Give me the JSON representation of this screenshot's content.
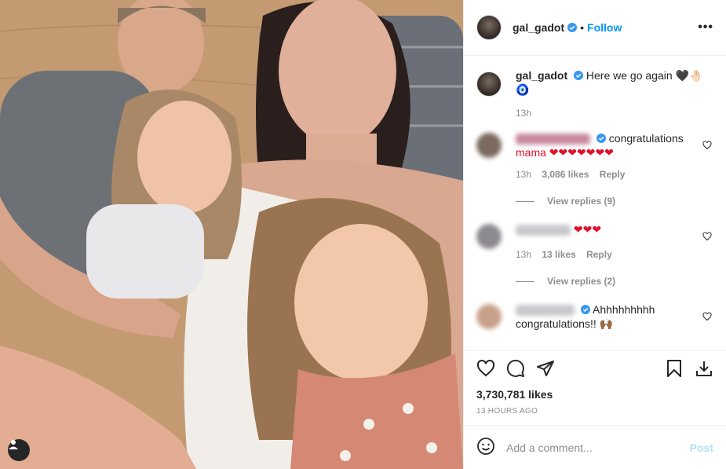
{
  "author": {
    "username": "gal_gadot",
    "verified": true,
    "follow_label": "Follow",
    "separator": "•"
  },
  "caption": {
    "username": "gal_gadot",
    "text": "Here we go again 🖤🤚🏻",
    "text2": "🧿",
    "time": "13h"
  },
  "comments": [
    {
      "text": "congratulations",
      "text2": "mama ❤❤❤❤❤❤❤",
      "time": "13h",
      "likes": "3,086 likes",
      "reply_label": "Reply",
      "view_replies": "View replies (9)"
    },
    {
      "text": "❤❤❤",
      "time": "13h",
      "likes": "13 likes",
      "reply_label": "Reply",
      "view_replies": "View replies (2)"
    },
    {
      "text": "Ahhhhhhhhh",
      "text2": "congratulations!! 🙌🏾"
    }
  ],
  "likes_count": "3,730,781 likes",
  "posted_ago": "13 HOURS AGO",
  "add_comment": {
    "placeholder": "Add a comment...",
    "post_label": "Post"
  },
  "icons": {
    "more": "more-options-icon",
    "heart": "heart-icon",
    "comment": "comment-icon",
    "share": "share-icon",
    "save": "bookmark-icon",
    "download": "download-icon",
    "emoji": "emoji-icon",
    "tag": "user-tag-icon",
    "verified": "verified-badge-icon"
  },
  "colors": {
    "accent": "#0095f6",
    "post_disabled": "#b2dffc",
    "muted": "#8e8e8e",
    "verified": "#3897f0"
  }
}
